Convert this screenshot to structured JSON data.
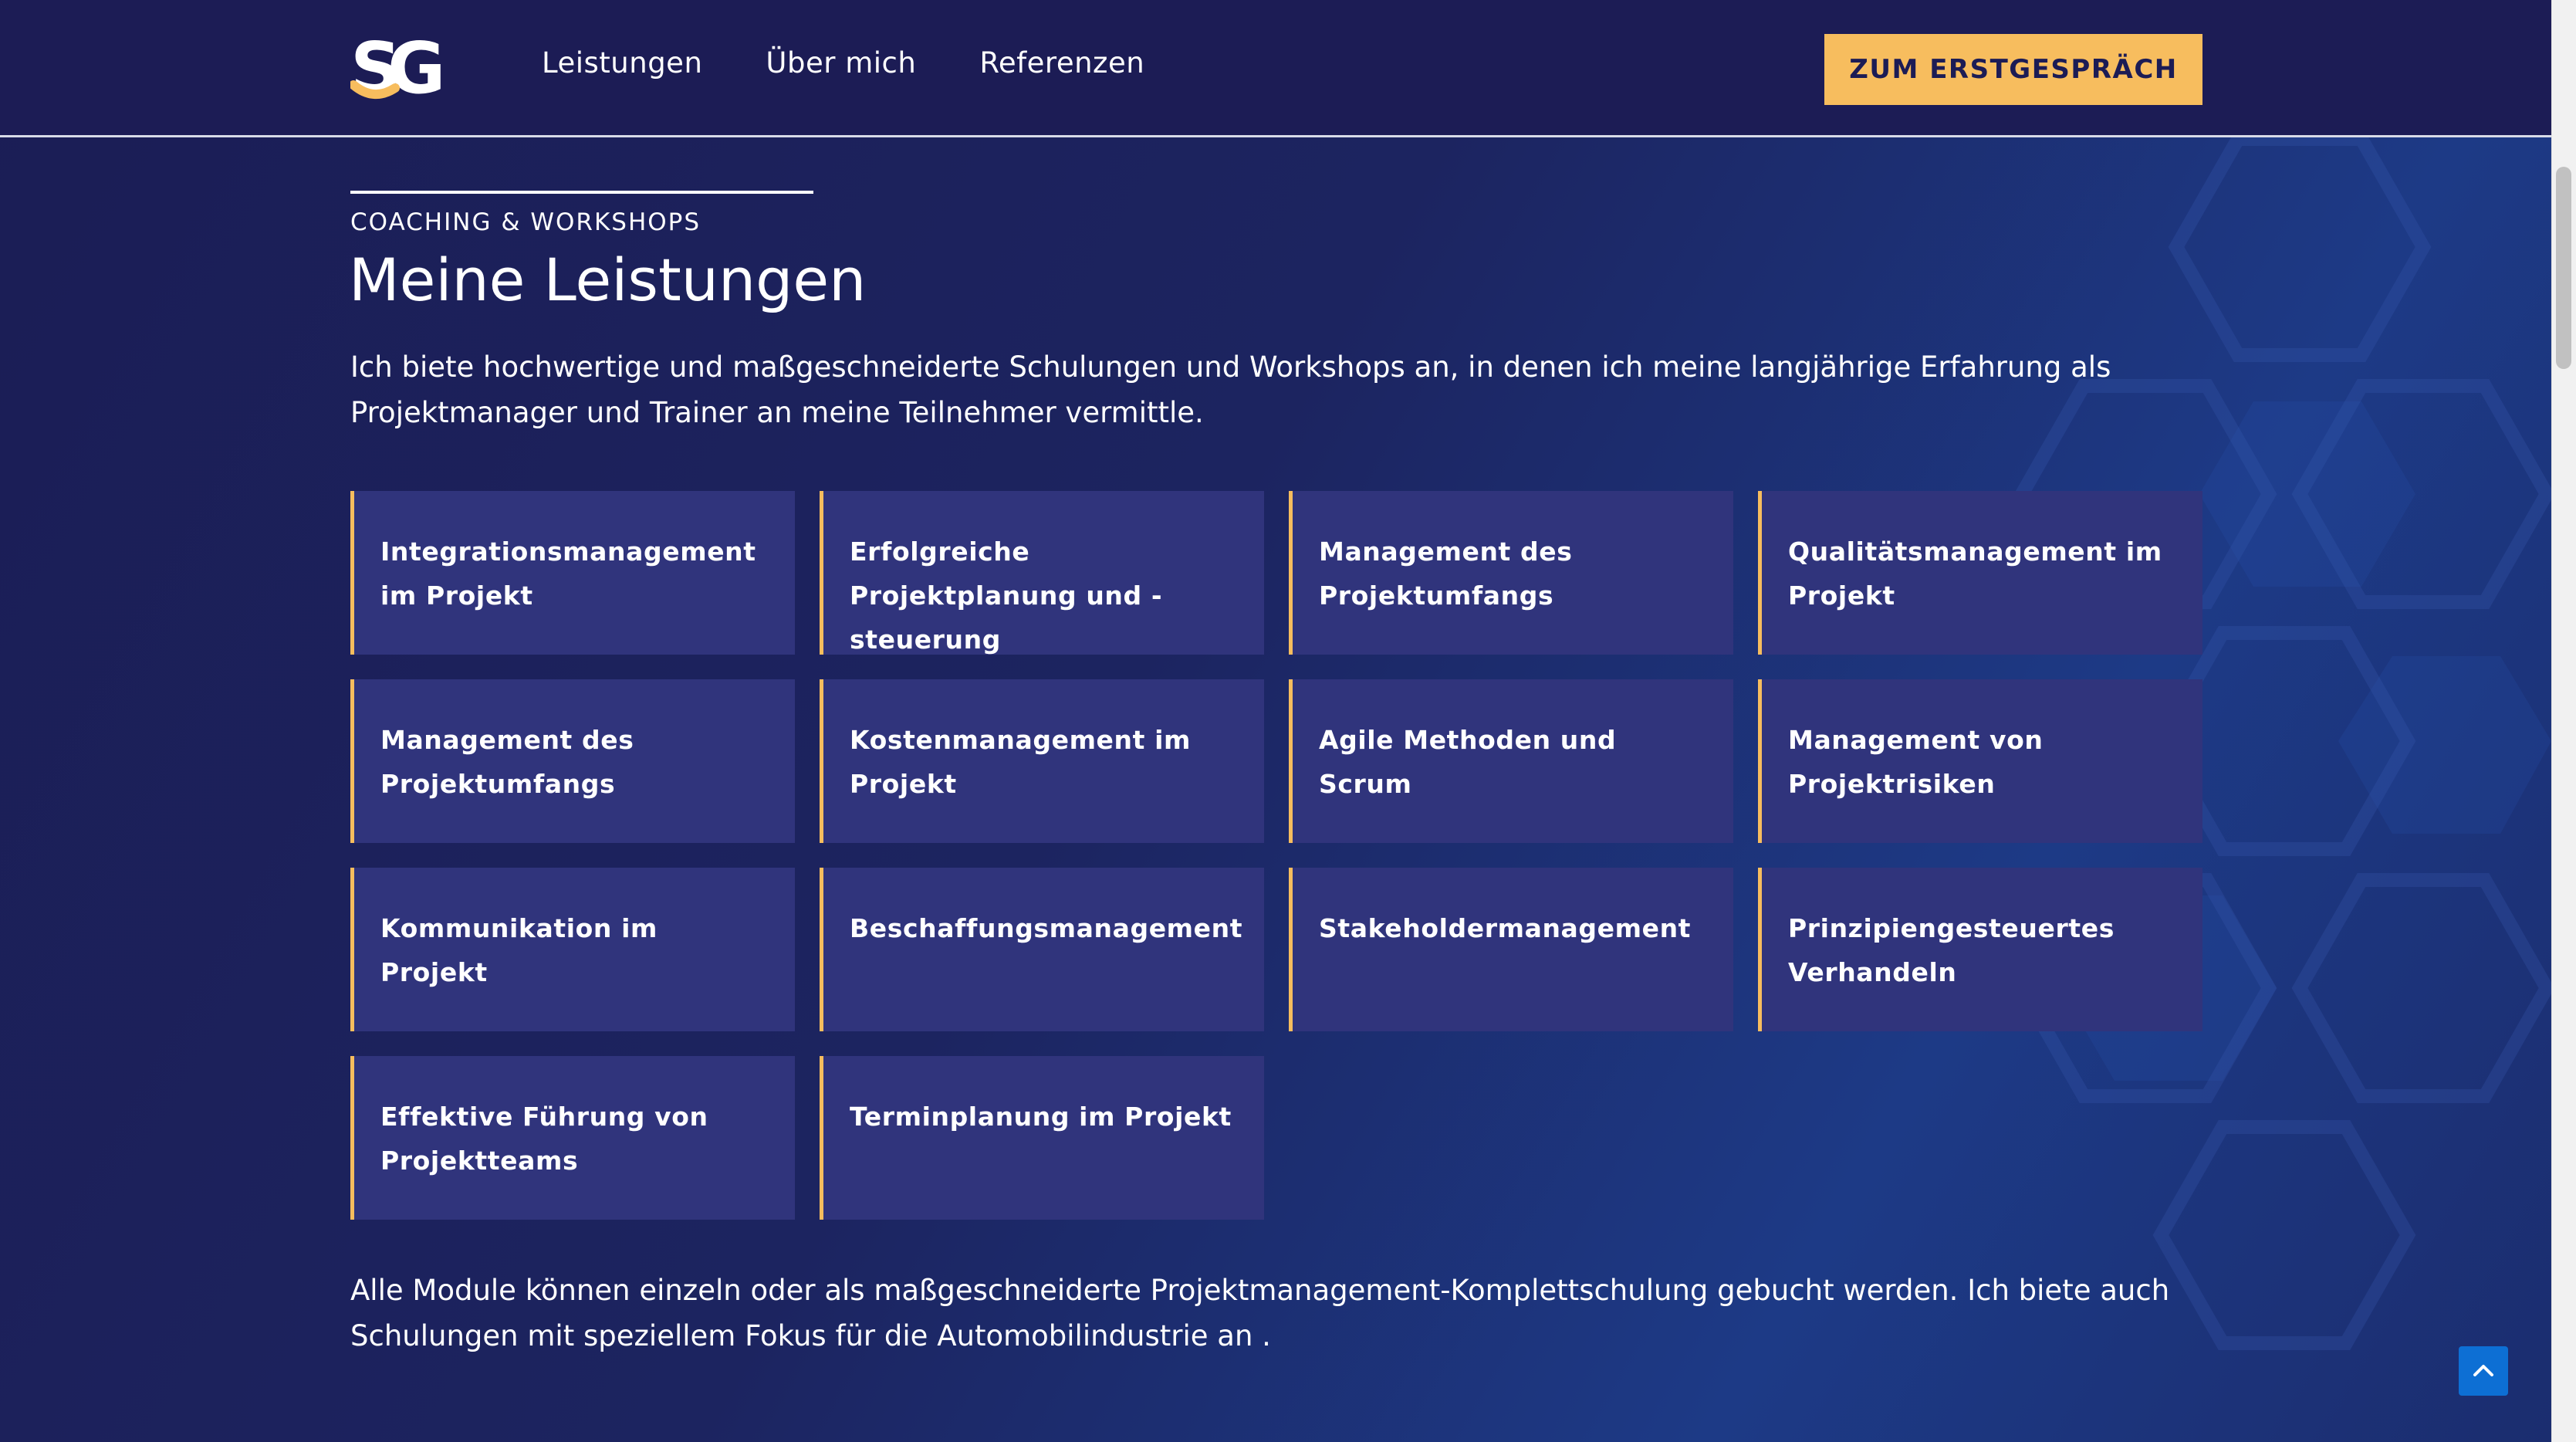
{
  "header": {
    "logo_text": "SG",
    "nav": [
      "Leistungen",
      "Über mich",
      "Referenzen"
    ],
    "cta_label": "ZUM ERSTGESPRÄCH"
  },
  "section": {
    "eyebrow": "COACHING & WORKSHOPS",
    "title": "Meine Leistungen",
    "intro": "Ich biete hochwertige und maßgeschneiderte Schulungen und Workshops an, in denen ich meine langjährige Erfahrung als Projektmanager und Trainer an meine Teilnehmer vermittle.",
    "cards": [
      "Integrationsmanagement im Projekt",
      "Erfolgreiche Projektplanung und -steuerung",
      "Management des Projektumfangs",
      "Qualitätsmanagement im Projekt",
      "Management des Projektumfangs",
      "Kostenmanagement im Projekt",
      "Agile Methoden und Scrum",
      "Management von Projektrisiken",
      "Kommunikation im Projekt",
      "Beschaffungsmanagement",
      "Stakeholdermanagement",
      "Prinzipiengesteuertes Verhandeln",
      "Effektive Führung von Projektteams",
      "Terminplanung im Projekt"
    ],
    "outro": "Alle Module können einzeln oder als maßgeschneiderte Projektmanagement-Komplettschulung gebucht werden. Ich biete auch Schulungen mit speziellem Fokus für die Automobilindustrie an ."
  },
  "colors": {
    "header_bg": "#1c1c55",
    "card_bg": "#30347c",
    "accent": "#f7bd5e",
    "back_to_top": "#0d6fd4"
  },
  "icons": {
    "back_to_top": "chevron-up-icon"
  }
}
